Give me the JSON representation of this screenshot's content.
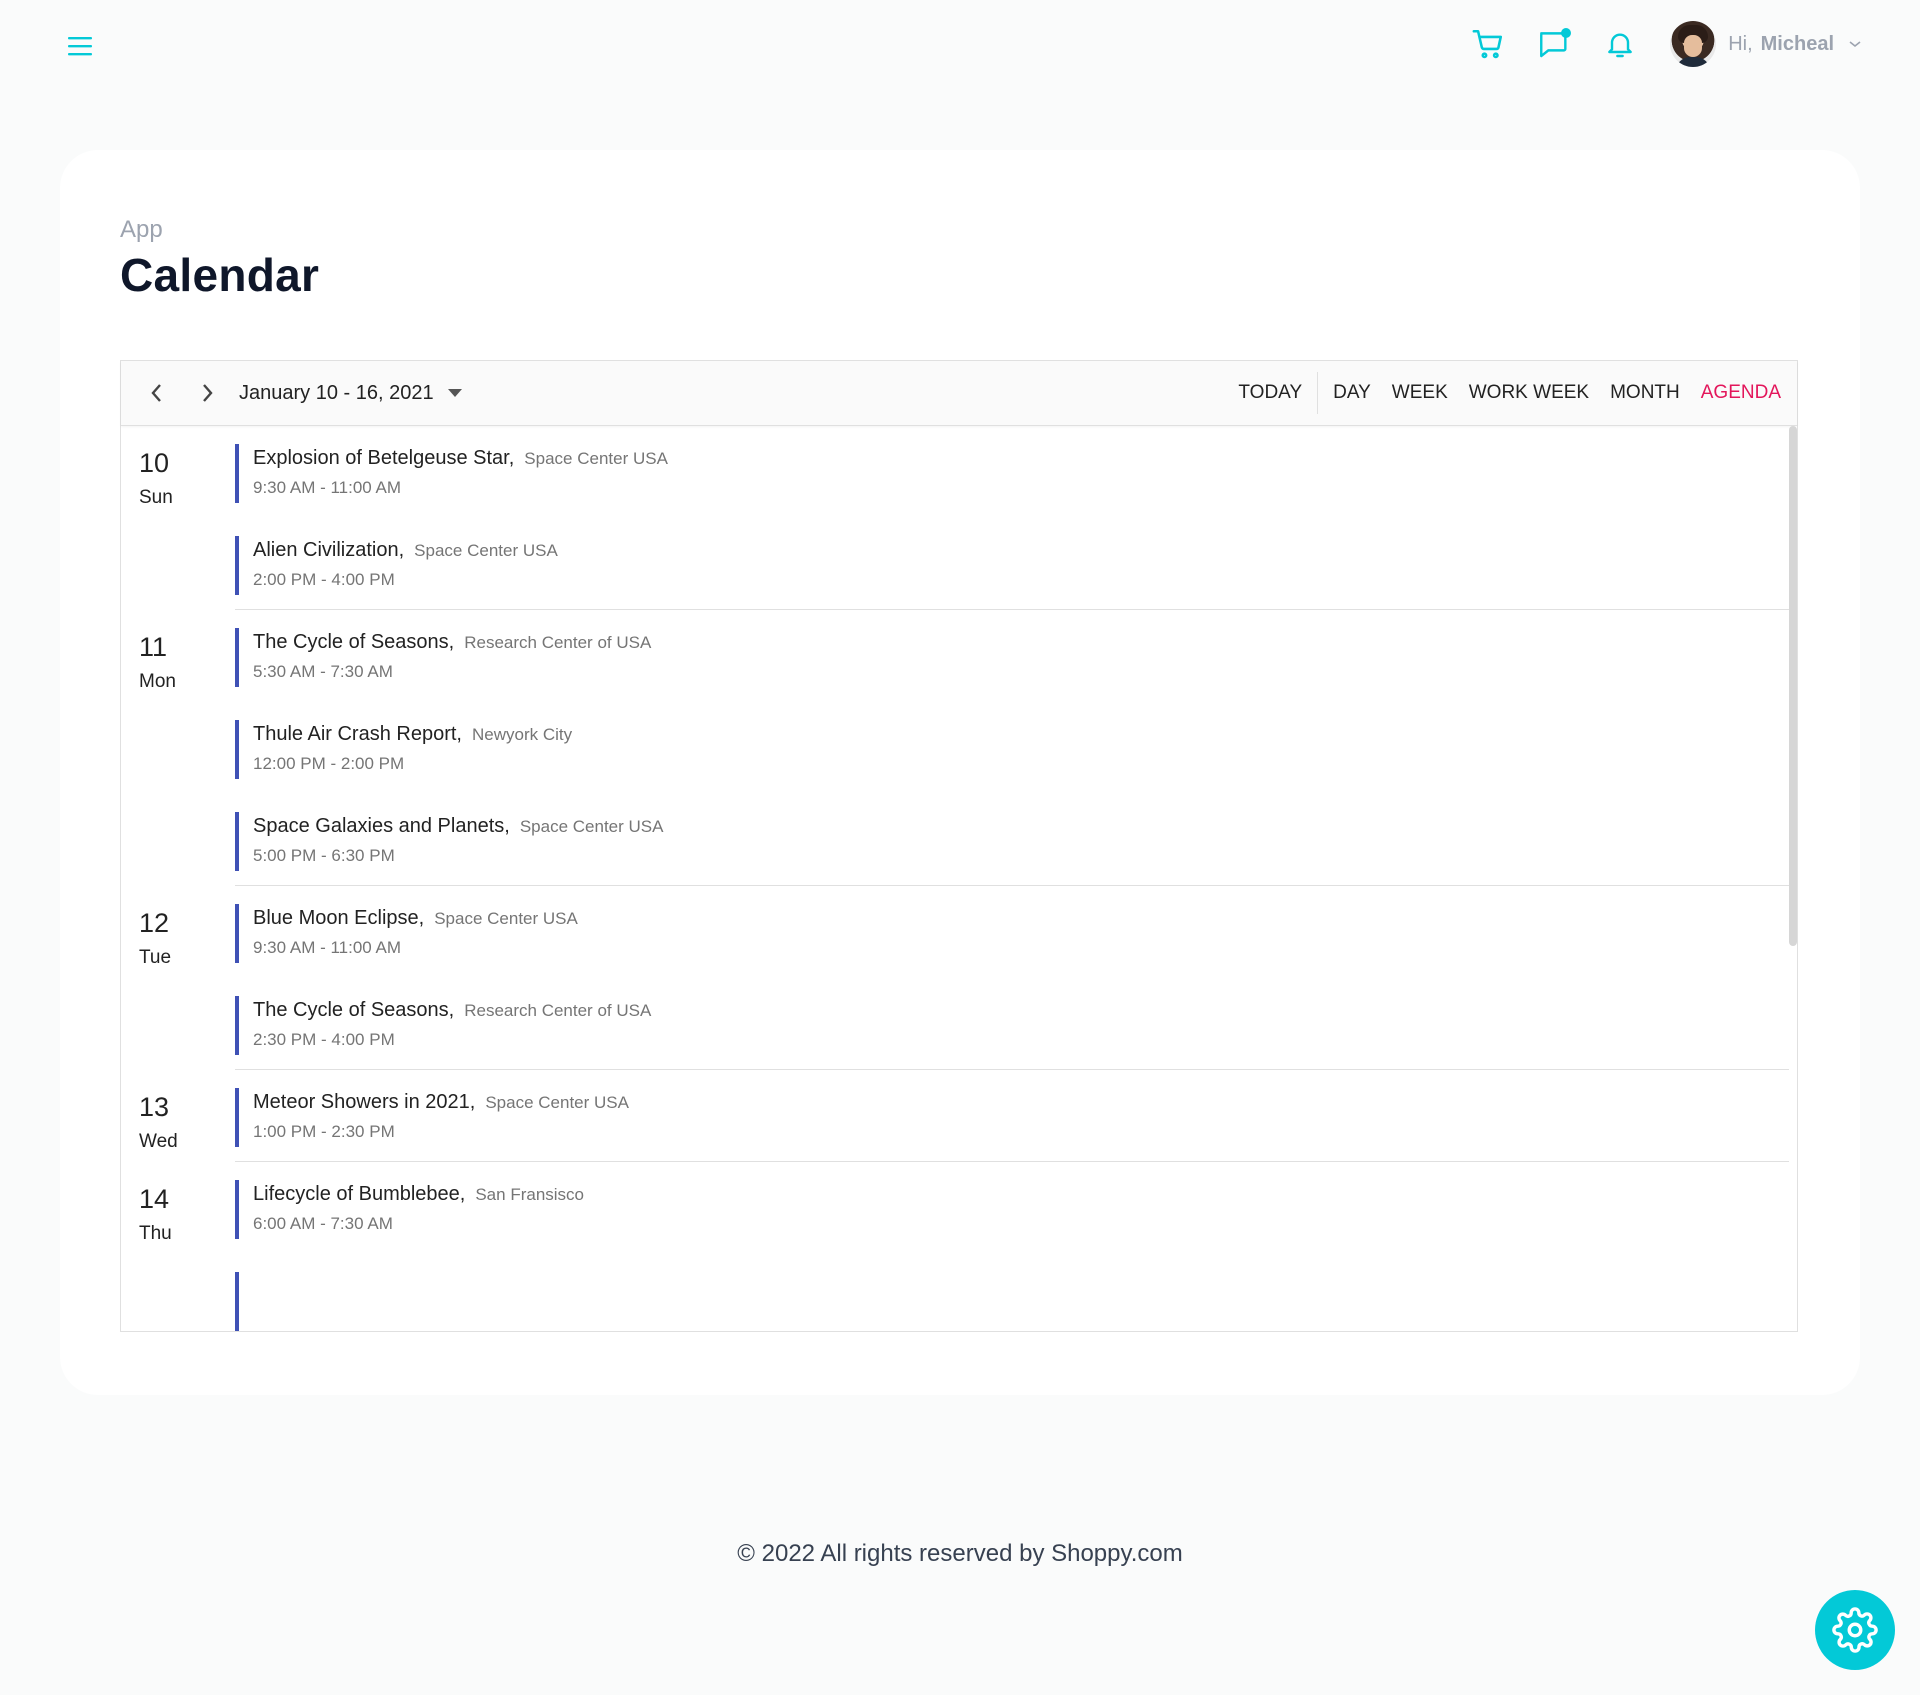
{
  "header": {
    "greeting": "Hi,",
    "user_name": "Micheal"
  },
  "breadcrumb": "App",
  "page_title": "Calendar",
  "scheduler": {
    "date_range": "January 10 - 16, 2021",
    "buttons": {
      "today": "TODAY",
      "day": "DAY",
      "week": "WEEK",
      "work_week": "WORK WEEK",
      "month": "MONTH",
      "agenda": "AGENDA"
    },
    "active_view": "AGENDA",
    "days": [
      {
        "num": "10",
        "name": "Sun",
        "events": [
          {
            "title": "Explosion of Betelgeuse Star,",
            "location": "Space Center USA",
            "time": "9:30 AM - 11:00 AM"
          },
          {
            "title": "Alien Civilization,",
            "location": "Space Center USA",
            "time": "2:00 PM - 4:00 PM"
          }
        ]
      },
      {
        "num": "11",
        "name": "Mon",
        "events": [
          {
            "title": "The Cycle of Seasons,",
            "location": "Research Center of USA",
            "time": "5:30 AM - 7:30 AM"
          },
          {
            "title": "Thule Air Crash Report,",
            "location": "Newyork City",
            "time": "12:00 PM - 2:00 PM"
          },
          {
            "title": "Space Galaxies and Planets,",
            "location": "Space Center USA",
            "time": "5:00 PM - 6:30 PM"
          }
        ]
      },
      {
        "num": "12",
        "name": "Tue",
        "events": [
          {
            "title": "Blue Moon Eclipse,",
            "location": "Space Center USA",
            "time": "9:30 AM - 11:00 AM"
          },
          {
            "title": "The Cycle of Seasons,",
            "location": "Research Center of USA",
            "time": "2:30 PM - 4:00 PM"
          }
        ]
      },
      {
        "num": "13",
        "name": "Wed",
        "events": [
          {
            "title": "Meteor Showers in 2021,",
            "location": "Space Center USA",
            "time": "1:00 PM - 2:30 PM"
          }
        ]
      },
      {
        "num": "14",
        "name": "Thu",
        "events": [
          {
            "title": "Lifecycle of Bumblebee,",
            "location": "San Fransisco",
            "time": "6:00 AM - 7:30 AM"
          },
          {
            "title": "",
            "location": "",
            "time": ""
          }
        ]
      }
    ]
  },
  "footer": "© 2022 All rights reserved by Shoppy.com",
  "colors": {
    "accent": "#03c9d7",
    "active_view": "#e3165b",
    "event_bar": "#3f51b5"
  },
  "icons": [
    "menu-icon",
    "cart-icon",
    "chat-icon",
    "bell-icon",
    "chevron-down-icon",
    "chevron-left-icon",
    "chevron-right-icon",
    "caret-down-icon",
    "settings-icon"
  ]
}
